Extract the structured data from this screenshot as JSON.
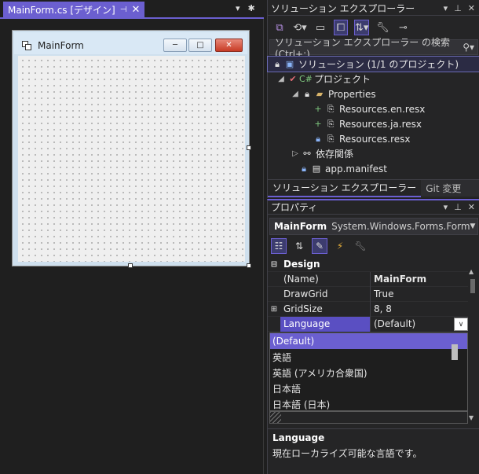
{
  "designer": {
    "tab_title": "MainForm.cs [デザイン]",
    "pin_icon": "pin-icon",
    "close_icon": "close-icon",
    "form": {
      "title": "MainForm",
      "min_label": "─",
      "max_label": "□",
      "close_label": "✕"
    }
  },
  "solution_explorer": {
    "title": "ソリューション エクスプローラー",
    "search_placeholder": "ソリューション エクスプローラー の検索 (Ctrl+;)",
    "tree": [
      {
        "label": "ソリューション (1/1 のプロジェクト)",
        "icon": "solution-icon"
      },
      {
        "label": "プロジェクト",
        "icon": "csharp-project-icon"
      },
      {
        "label": "Properties",
        "icon": "folder-icon"
      },
      {
        "label": "Resources.en.resx",
        "icon": "resx-file-icon"
      },
      {
        "label": "Resources.ja.resx",
        "icon": "resx-file-icon"
      },
      {
        "label": "Resources.resx",
        "icon": "resx-file-icon"
      },
      {
        "label": "依存関係",
        "icon": "dependencies-icon"
      },
      {
        "label": "app.manifest",
        "icon": "manifest-file-icon"
      }
    ],
    "tabs": [
      {
        "label": "ソリューション エクスプローラー"
      },
      {
        "label": "Git 変更"
      }
    ]
  },
  "properties": {
    "title": "プロパティ",
    "object_name": "MainForm",
    "object_type": "System.Windows.Forms.Form",
    "rows": [
      {
        "name": "Design",
        "value": ""
      },
      {
        "name": "(Name)",
        "value": "MainForm"
      },
      {
        "name": "DrawGrid",
        "value": "True"
      },
      {
        "name": "GridSize",
        "value": "8, 8"
      },
      {
        "name": "Language",
        "value": "(Default)"
      }
    ],
    "language_options": [
      "(Default)",
      "英語",
      "英語 (アメリカ合衆国)",
      "日本語",
      "日本語 (日本)"
    ],
    "description_title": "Language",
    "description_text": "現在ローカライズ可能な言語です。"
  },
  "colors": {
    "accent": "#6b5fd0",
    "panel_bg": "#252526",
    "editor_bg": "#1f1f1f"
  }
}
